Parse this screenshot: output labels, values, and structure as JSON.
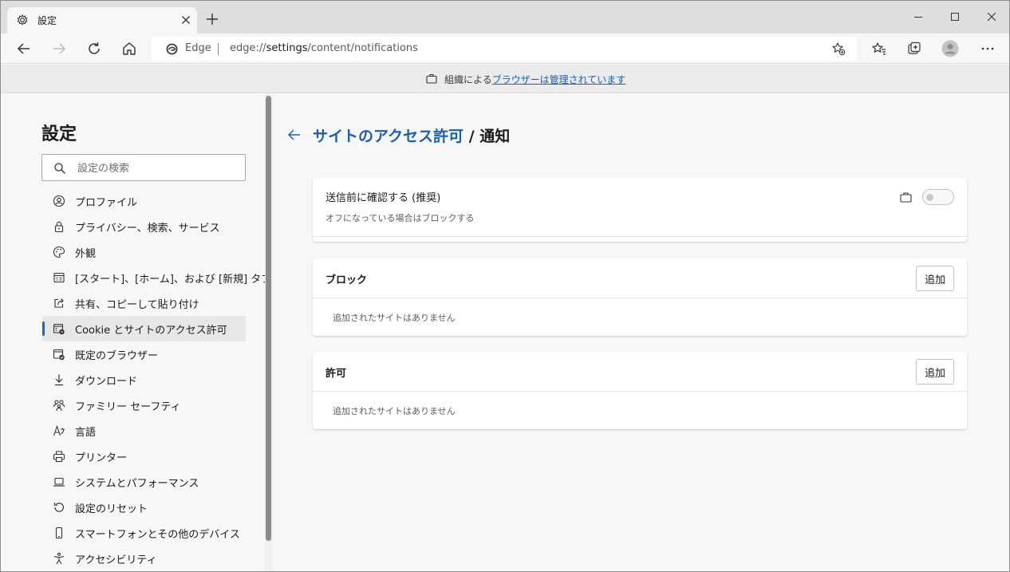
{
  "colors": {
    "accent": "#0f6cbd",
    "link": "#1a5fb4",
    "tabstrip_bg": "#dedede",
    "page_bg": "#f7f7f7",
    "card_bg": "#ffffff"
  },
  "browser": {
    "tab": {
      "title": "設定",
      "icon": "gear-icon"
    },
    "toolbar": {
      "edge_label": "Edge",
      "url_scheme": "edge://",
      "url_host": "settings",
      "url_path": "/content/notifications"
    },
    "managed_bar": {
      "prefix": "組織による",
      "link": "ブラウザーは管理されています"
    }
  },
  "sidebar": {
    "title": "設定",
    "search_placeholder": "設定の検索",
    "items": [
      {
        "label": "プロファイル",
        "icon": "profile-icon",
        "active": false
      },
      {
        "label": "プライバシー、検索、サービス",
        "icon": "lock-icon",
        "active": false
      },
      {
        "label": "外観",
        "icon": "palette-icon",
        "active": false
      },
      {
        "label": "[スタート]、[ホーム]、および [新規] タブ",
        "icon": "start-home-icon",
        "active": false
      },
      {
        "label": "共有、コピーして貼り付け",
        "icon": "share-icon",
        "active": false
      },
      {
        "label": "Cookie とサイトのアクセス許可",
        "icon": "cookie-permissions-icon",
        "active": true
      },
      {
        "label": "既定のブラウザー",
        "icon": "default-browser-icon",
        "active": false
      },
      {
        "label": "ダウンロード",
        "icon": "download-icon",
        "active": false
      },
      {
        "label": "ファミリー セーフティ",
        "icon": "family-icon",
        "active": false
      },
      {
        "label": "言語",
        "icon": "language-icon",
        "active": false
      },
      {
        "label": "プリンター",
        "icon": "printer-icon",
        "active": false
      },
      {
        "label": "システムとパフォーマンス",
        "icon": "laptop-icon",
        "active": false
      },
      {
        "label": "設定のリセット",
        "icon": "reset-icon",
        "active": false
      },
      {
        "label": "スマートフォンとその他のデバイス",
        "icon": "phone-icon",
        "active": false
      },
      {
        "label": "アクセシビリティ",
        "icon": "accessibility-icon",
        "active": false
      }
    ]
  },
  "main": {
    "breadcrumb": {
      "parent": "サイトのアクセス許可",
      "separator": "/",
      "current": "通知"
    },
    "ask_card": {
      "title": "送信前に確認する (推奨)",
      "subtitle": "オフになっている場合はブロックする",
      "toggle_on": false
    },
    "block_section": {
      "title": "ブロック",
      "add_label": "追加",
      "empty_text": "追加されたサイトはありません"
    },
    "allow_section": {
      "title": "許可",
      "add_label": "追加",
      "empty_text": "追加されたサイトはありません"
    }
  }
}
